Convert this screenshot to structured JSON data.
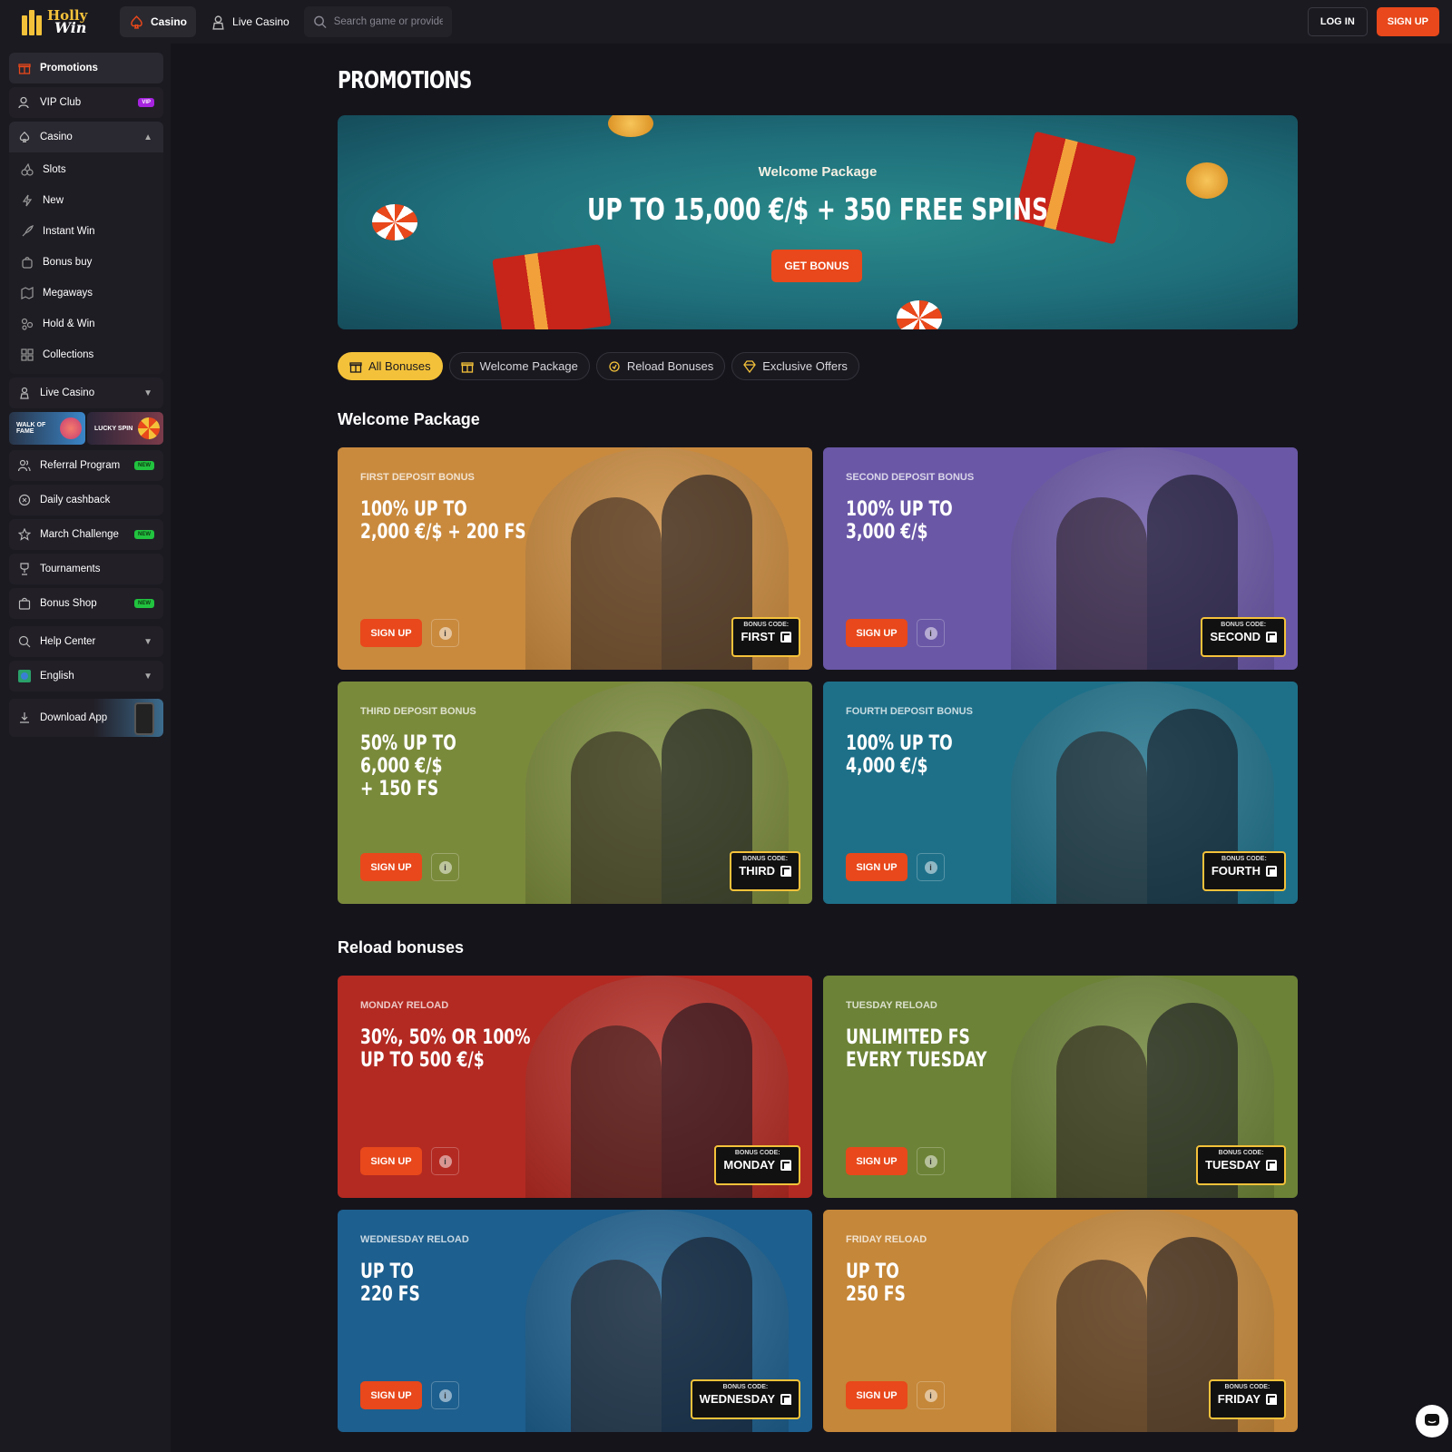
{
  "brand": {
    "logo_line1": "Holly",
    "logo_line2": "Win"
  },
  "topnav": {
    "casino_label": "Casino",
    "live_casino_label": "Live Casino",
    "search_placeholder": "Search game or provider",
    "login_label": "LOG IN",
    "signup_label": "SIGN UP"
  },
  "sidebar": {
    "promotions": "Promotions",
    "vip_club": "VIP Club",
    "vip_badge": "VIP",
    "casino": "Casino",
    "casino_sub": [
      "Slots",
      "New",
      "Instant Win",
      "Bonus buy",
      "Megaways",
      "Hold & Win",
      "Collections"
    ],
    "live_casino": "Live Casino",
    "tile_walk_of_fame": "WALK OF FAME",
    "tile_lucky_spin": "LUCKY SPIN",
    "referral": "Referral Program",
    "daily_cashback": "Daily cashback",
    "march_challenge": "March Challenge",
    "tournaments": "Tournaments",
    "bonus_shop": "Bonus Shop",
    "new_badge": "NEW",
    "help_center": "Help Center",
    "language": "English",
    "download_app": "Download App"
  },
  "main": {
    "page_title": "PROMOTIONS",
    "hero": {
      "subtitle": "Welcome Package",
      "title": "UP TO 15,000 €/$ + 350 FREE SPINS",
      "button": "GET BONUS"
    },
    "filters": [
      "All Bonuses",
      "Welcome Package",
      "Reload Bonuses",
      "Exclusive Offers"
    ],
    "welcome_section": "Welcome Package",
    "reload_section": "Reload bonuses",
    "card_button": "SIGN UP",
    "code_label": "BONUS CODE:",
    "welcome_cards": [
      {
        "label": "FIRST DEPOSIT BONUS",
        "title": "100% UP TO\n2,000 €/$ + 200 FS",
        "code": "FIRST",
        "color": "#c98a3e"
      },
      {
        "label": "SECOND DEPOSIT BONUS",
        "title": "100% UP TO\n3,000 €/$",
        "code": "SECOND",
        "color": "#6a57a6"
      },
      {
        "label": "THIRD DEPOSIT BONUS",
        "title": "50% UP TO\n6,000 €/$\n+ 150 FS",
        "code": "THIRD",
        "color": "#7a8a3b"
      },
      {
        "label": "FOURTH DEPOSIT BONUS",
        "title": "100% UP TO\n4,000 €/$",
        "code": "FOURTH",
        "color": "#1e7089"
      }
    ],
    "reload_cards": [
      {
        "label": "MONDAY RELOAD",
        "title": "30%, 50% OR 100%\nUP TO 500 €/$",
        "code": "MONDAY",
        "color": "#b32a22"
      },
      {
        "label": "TUESDAY RELOAD",
        "title": "UNLIMITED FS\nEVERY TUESDAY",
        "code": "TUESDAY",
        "color": "#6c8236"
      },
      {
        "label": "WEDNESDAY RELOAD",
        "title": "UP TO\n220 FS",
        "code": "WEDNESDAY",
        "color": "#1d5f8e"
      },
      {
        "label": "FRIDAY RELOAD",
        "title": "UP TO\n250 FS",
        "code": "FRIDAY",
        "color": "#c58739"
      }
    ]
  },
  "colors": {
    "accent": "#e8481b",
    "gold": "#f4c23a",
    "bg": "#15141b"
  }
}
